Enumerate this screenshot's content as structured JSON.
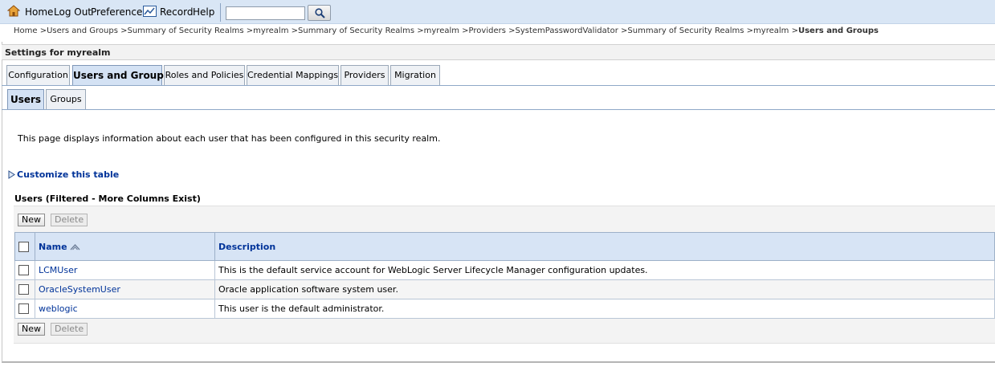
{
  "toolbar": {
    "home": "Home",
    "logout": "Log Out",
    "preferences": "Preferences",
    "record": "Record",
    "help": "Help",
    "search_value": ""
  },
  "breadcrumb": {
    "path": "Home >Users and Groups >Summary of Security Realms >myrealm >Summary of Security Realms >myrealm >Providers >SystemPasswordValidator >Summary of Security Realms >myrealm >",
    "current": "Users and Groups"
  },
  "settings_title": "Settings for myrealm",
  "tabs": [
    {
      "label": "Configuration",
      "active": false
    },
    {
      "label": "Users and Groups",
      "active": true
    },
    {
      "label": "Roles and Policies",
      "active": false
    },
    {
      "label": "Credential Mappings",
      "active": false
    },
    {
      "label": "Providers",
      "active": false
    },
    {
      "label": "Migration",
      "active": false
    }
  ],
  "subtabs": [
    {
      "label": "Users",
      "active": true
    },
    {
      "label": "Groups",
      "active": false
    }
  ],
  "intro": "This page displays information about each user that has been configured in this security realm.",
  "customize": "Customize this table",
  "table": {
    "caption": "Users (Filtered - More Columns Exist)",
    "new_label": "New",
    "delete_label": "Delete",
    "columns": [
      "Name",
      "Description"
    ],
    "rows": [
      {
        "name": "LCMUser",
        "description": "This is the default service account for WebLogic Server Lifecycle Manager configuration updates."
      },
      {
        "name": "OracleSystemUser",
        "description": "Oracle application software system user."
      },
      {
        "name": "weblogic",
        "description": "This user is the default administrator."
      }
    ]
  }
}
